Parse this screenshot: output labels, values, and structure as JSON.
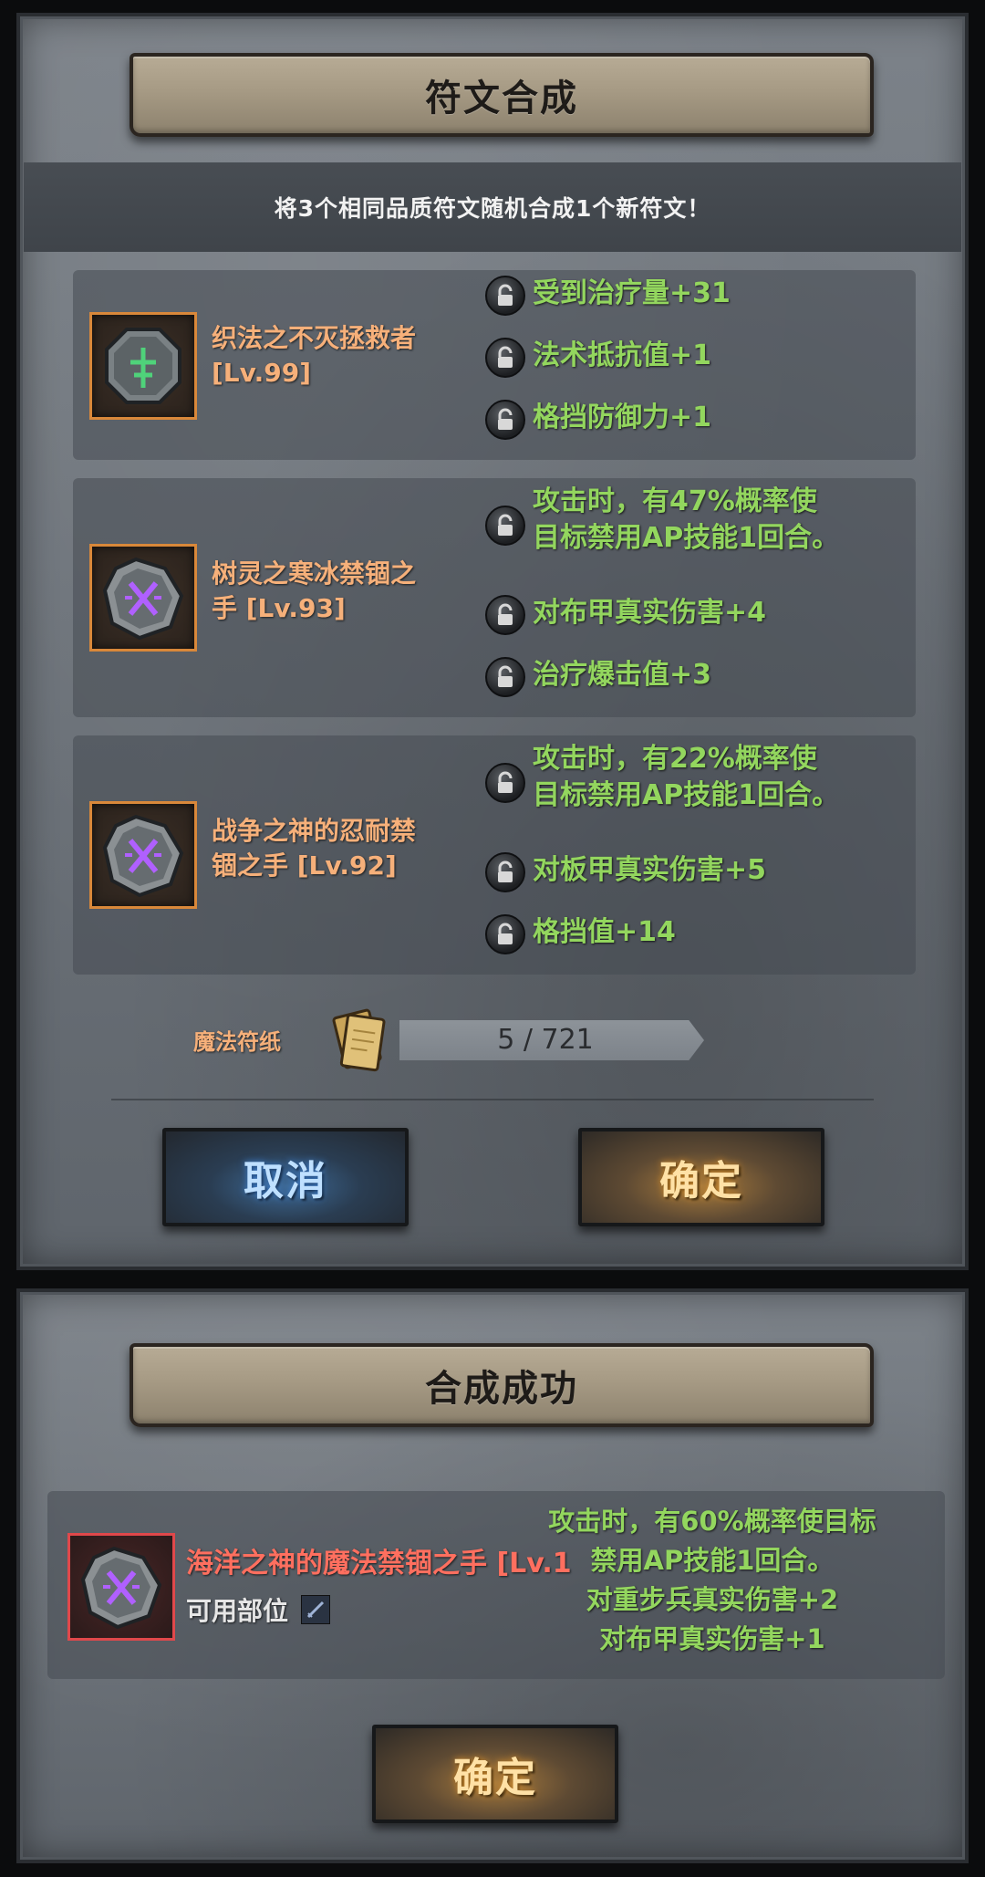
{
  "merge_panel": {
    "title": "符文合成",
    "subtitle": "将3个相同品质符文随机合成1个新符文！",
    "runes": [
      {
        "name": "织法之不灭拯救者",
        "level": "[Lv.99]",
        "attrs": [
          "受到治疗量+31",
          "法术抵抗值+1",
          "格挡防御力+1"
        ]
      },
      {
        "name": "树灵之寒冰禁锢之",
        "name2": "手 [Lv.93]",
        "attrs": [
          "攻击时，有47%概率使",
          "目标禁用AP技能1回合。",
          "对布甲真实伤害+4",
          "治疗爆击值+3"
        ]
      },
      {
        "name": "战争之神的忍耐禁",
        "name2": "锢之手 [Lv.92]",
        "attrs": [
          "攻击时，有22%概率使",
          "目标禁用AP技能1回合。",
          "对板甲真实伤害+5",
          "格挡值+14"
        ]
      }
    ],
    "resource": {
      "label": "魔法符纸",
      "value": "5 / 721"
    },
    "cancel_label": "取消",
    "confirm_label": "确定"
  },
  "result_panel": {
    "title": "合成成功",
    "rune_name": "海洋之神的魔法禁锢之手 [Lv.1",
    "usable_label": "可用部位",
    "attrs": [
      "攻击时，有60%概率使目标",
      "禁用AP技能1回合。",
      "对重步兵真实伤害+2",
      "对布甲真实伤害+1"
    ],
    "confirm_label": "确定"
  },
  "colors": {
    "attr_green": "#93d65e",
    "name_orange": "#f6b07a",
    "result_red": "#ff6f5f"
  }
}
